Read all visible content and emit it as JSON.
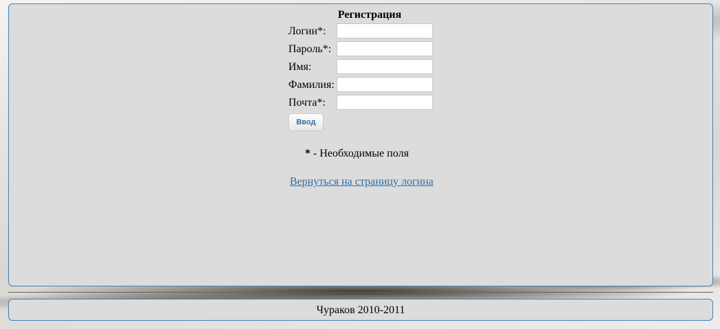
{
  "form": {
    "title": "Регистрация",
    "fields": [
      {
        "label": "Логин*:",
        "value": "",
        "placeholder": ""
      },
      {
        "label": "Пароль*:",
        "value": "",
        "placeholder": ""
      },
      {
        "label": "Имя:",
        "value": "",
        "placeholder": ""
      },
      {
        "label": "Фамилия:",
        "value": "",
        "placeholder": ""
      },
      {
        "label": "Почта*:",
        "value": "",
        "placeholder": ""
      }
    ],
    "submit_label": "Ввод",
    "required_star": "*",
    "required_note": " - Необходимые поля",
    "back_link": "Вернуться на страницу логина"
  },
  "footer": {
    "text": "Чураков 2010-2011"
  },
  "colors": {
    "panel_background": "#dcdcdc",
    "panel_border": "#3b83bd",
    "link": "#2e6ea6"
  }
}
